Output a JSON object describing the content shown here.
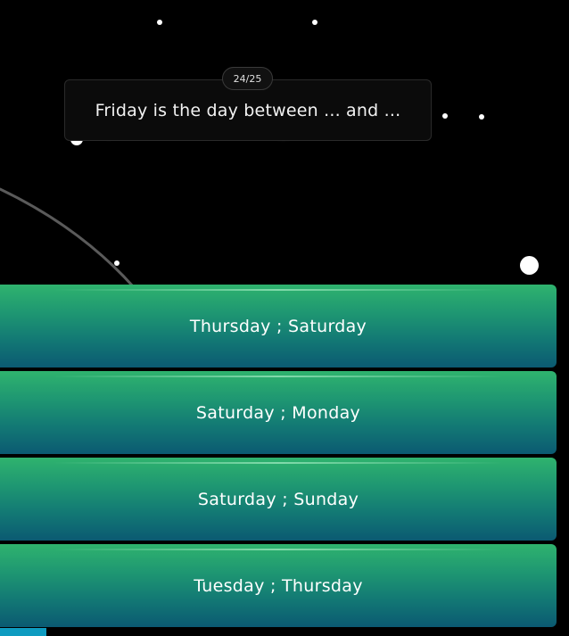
{
  "quiz": {
    "counter": "24/25",
    "question": "Friday is the day between ... and ...",
    "answers": [
      {
        "label": "Thursday ; Saturday"
      },
      {
        "label": "Saturday ; Monday"
      },
      {
        "label": "Saturday ; Sunday"
      },
      {
        "label": "Tuesday ; Thursday"
      }
    ]
  },
  "colors": {
    "background": "#000000",
    "answer_top": "#2fb36e",
    "answer_bottom": "#0b5a72",
    "card_background": "#0b0b0b"
  }
}
